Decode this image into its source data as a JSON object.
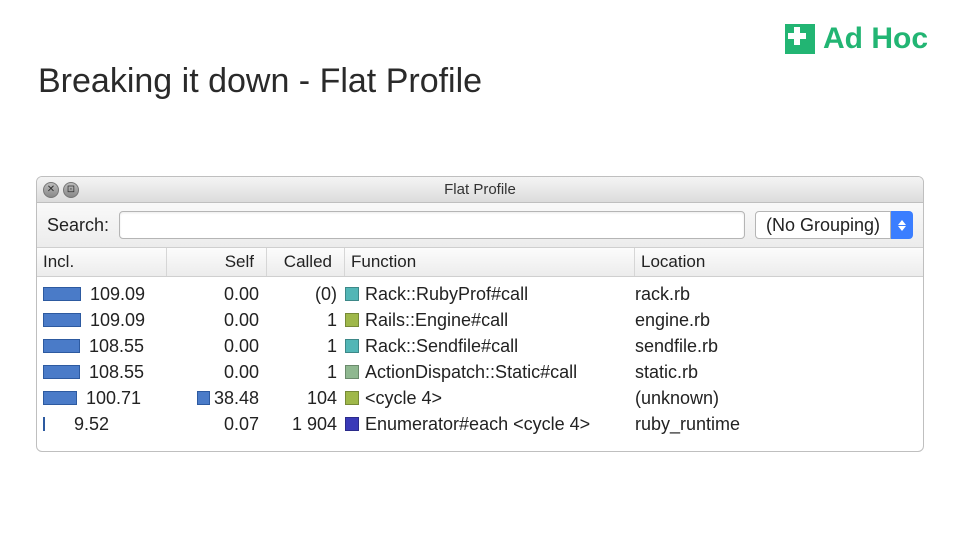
{
  "brand": {
    "name": "Ad Hoc"
  },
  "slide": {
    "title": "Breaking it down - Flat Profile"
  },
  "window": {
    "title": "Flat Profile",
    "close_label": "✕",
    "button2_label": "⊡"
  },
  "toolbar": {
    "search_label": "Search:",
    "search_value": "",
    "grouping_selected": "(No Grouping)"
  },
  "columns": {
    "incl": "Incl.",
    "self": "Self",
    "called": "Called",
    "function": "Function",
    "location": "Location"
  },
  "chart_data": {
    "type": "table",
    "title": "Flat Profile",
    "columns": [
      "Incl.",
      "Self",
      "Called",
      "Function",
      "Location"
    ],
    "rows": [
      {
        "incl": 109.09,
        "self": 0.0,
        "called": "(0)",
        "function": "Rack::RubyProf#call",
        "swatch": "#52b6b6",
        "location": "rack.rb",
        "incl_bar": 38,
        "self_bar": 0
      },
      {
        "incl": 109.09,
        "self": 0.0,
        "called": "1",
        "function": "Rails::Engine#call",
        "swatch": "#9fb84a",
        "location": "engine.rb",
        "incl_bar": 38,
        "self_bar": 0
      },
      {
        "incl": 108.55,
        "self": 0.0,
        "called": "1",
        "function": "Rack::Sendfile#call",
        "swatch": "#52b6b6",
        "location": "sendfile.rb",
        "incl_bar": 37,
        "self_bar": 0
      },
      {
        "incl": 108.55,
        "self": 0.0,
        "called": "1",
        "function": "ActionDispatch::Static#call",
        "swatch": "#8fb890",
        "location": "static.rb",
        "incl_bar": 37,
        "self_bar": 0
      },
      {
        "incl": 100.71,
        "self": 38.48,
        "called": "104",
        "function": "<cycle 4>",
        "swatch": "#9fb84a",
        "location": "(unknown)",
        "incl_bar": 34,
        "self_bar": 13
      },
      {
        "incl": 9.52,
        "self": 0.07,
        "called": "1 904",
        "function": "Enumerator#each <cycle 4>",
        "swatch": "#3a3ab8",
        "location": "ruby_runtime",
        "incl_bar": 2,
        "self_bar": 0
      }
    ]
  }
}
